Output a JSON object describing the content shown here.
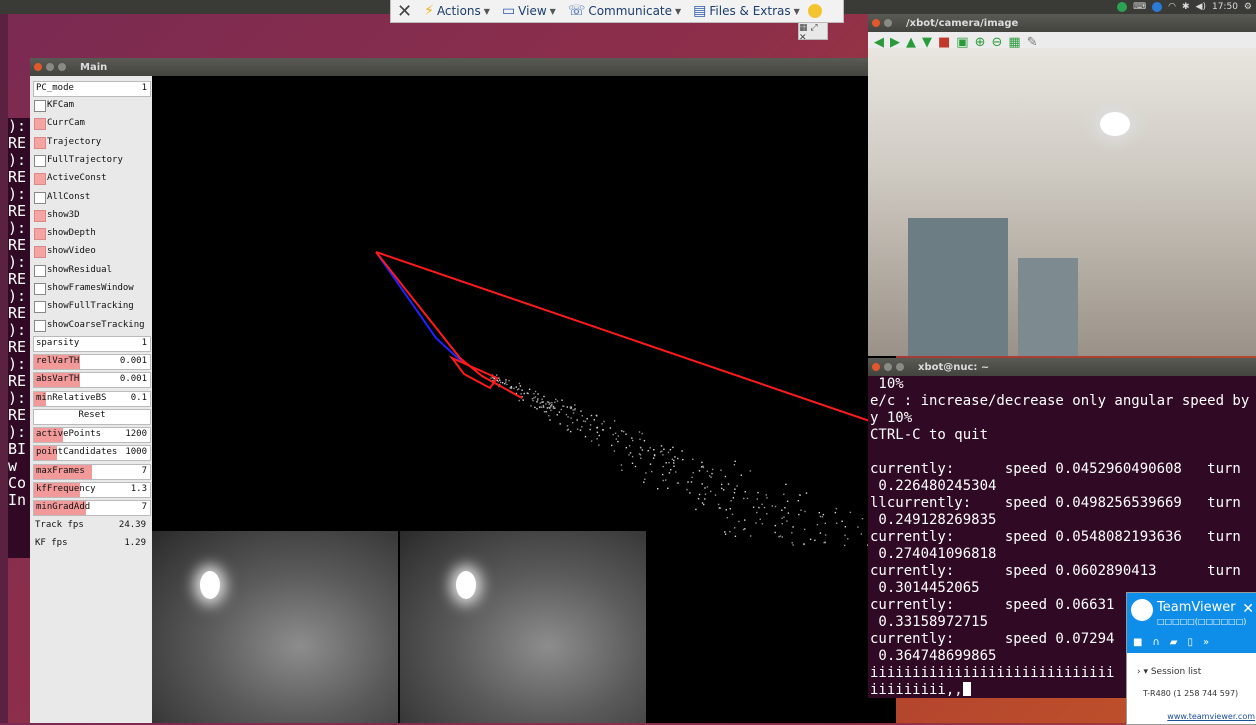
{
  "topbar": {
    "clock": "17:50"
  },
  "teamviewer_toolbar": {
    "items": [
      {
        "label": "Actions",
        "icon": "bolt-icon"
      },
      {
        "label": "View",
        "icon": "monitor-icon"
      },
      {
        "label": "Communicate",
        "icon": "chat-icon"
      },
      {
        "label": "Files & Extras",
        "icon": "file-icon"
      }
    ]
  },
  "background_terminal": {
    "lines": [
      "):",
      "RE",
      "):",
      "RE",
      "):",
      "RE",
      "):",
      "RE",
      "):",
      "RE",
      "):",
      "RE",
      "):",
      "RE",
      "):",
      "RE",
      "):",
      "RE",
      "):",
      "BI",
      "w",
      "Co",
      "In"
    ]
  },
  "main_window": {
    "title": "Main",
    "panel": {
      "pc_mode": {
        "label": "PC_mode",
        "value": "1"
      },
      "checkboxes": [
        {
          "label": "KFCam",
          "checked": false
        },
        {
          "label": "CurrCam",
          "checked": true
        },
        {
          "label": "Trajectory",
          "checked": true
        },
        {
          "label": "FullTrajectory",
          "checked": false
        },
        {
          "label": "ActiveConst",
          "checked": true
        },
        {
          "label": "AllConst",
          "checked": false
        },
        {
          "label": "show3D",
          "checked": true
        },
        {
          "label": "showDepth",
          "checked": true
        },
        {
          "label": "showVideo",
          "checked": true
        },
        {
          "label": "showResidual",
          "checked": false
        },
        {
          "label": "showFramesWindow",
          "checked": false
        },
        {
          "label": "showFullTracking",
          "checked": false
        },
        {
          "label": "showCoarseTracking",
          "checked": false
        }
      ],
      "sparsity": {
        "label": "sparsity",
        "value": "1"
      },
      "sliders_a": [
        {
          "label": "relVarTH",
          "value": "0.001",
          "fill": 0.4
        },
        {
          "label": "absVarTH",
          "value": "0.001",
          "fill": 0.4
        },
        {
          "label": "minRelativeBS",
          "value": "0.1",
          "fill": 0.1
        }
      ],
      "reset_label": "Reset",
      "sliders_b": [
        {
          "label": "activePoints",
          "value": "1200",
          "fill": 0.25
        },
        {
          "label": "pointCandidates",
          "value": "1000",
          "fill": 0.2
        },
        {
          "label": "maxFrames",
          "value": "7",
          "fill": 0.5
        },
        {
          "label": "kfFrequency",
          "value": "1.3",
          "fill": 0.4
        },
        {
          "label": "minGradAdd",
          "value": "7",
          "fill": 0.45
        }
      ],
      "track_fps": {
        "label": "Track fps",
        "value": "24.39"
      },
      "kf_fps": {
        "label": "KF fps",
        "value": "1.29"
      }
    }
  },
  "camera_window": {
    "title": "/xbot/camera/image"
  },
  "terminal": {
    "title": "xbot@nuc: ~",
    "lines": [
      " 10%",
      "e/c : increase/decrease only angular speed by",
      "y 10%",
      "CTRL-C to quit",
      "",
      "currently:      speed 0.0452960490608   turn",
      " 0.226480245304",
      "llcurrently:    speed 0.0498256539669   turn",
      " 0.249128269835",
      "currently:      speed 0.0548082193636   turn",
      " 0.274041096818",
      "currently:      speed 0.0602890413      turn",
      " 0.3014452065",
      "currently:      speed 0.06631",
      " 0.33158972715",
      "currently:      speed 0.07294",
      " 0.364748699865",
      "iiiiiiiiiiiiiiiiiiiiiiiiiiiii"
    ],
    "prompt_line": "iiiiiiiii,,"
  },
  "teamviewer_panel": {
    "name": "TeamViewer",
    "subtitle": "□□□□□(□□□□□□)",
    "session_list_label": "Session list",
    "session_entry": "T-R480 (1 258 744 597)",
    "link": "www.teamviewer.com"
  },
  "colors": {
    "trajectory_red": "#ff1a1a",
    "camera_blue": "#2222ff",
    "terminal_bg": "#300a24",
    "teamviewer_blue": "#0e8ee9"
  }
}
